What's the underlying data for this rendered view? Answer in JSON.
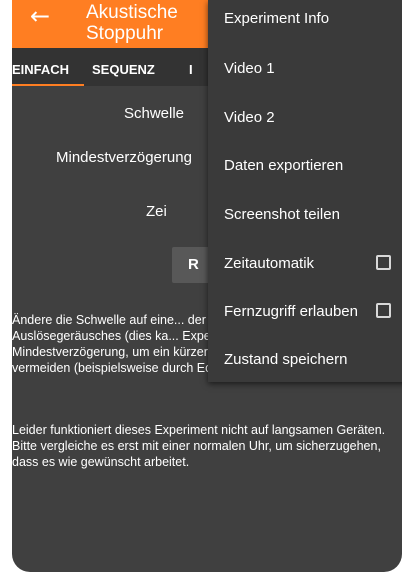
{
  "appbar": {
    "title": "Akustische Stoppuhr",
    "back_icon": "arrow-left-icon"
  },
  "tabs": [
    {
      "label": "EINFACH",
      "active": true
    },
    {
      "label": "SEQUENZ",
      "active": false
    },
    {
      "label": "I",
      "active": false
    }
  ],
  "settings": {
    "threshold_label": "Schwelle",
    "min_delay_label": "Mindestverzögerung",
    "time_label": "Zei",
    "start_button_label": "R"
  },
  "description": {
    "paragraph1": "Ändere die Schwelle auf eine... der Umgebungsgeräusche, a... Auslösegeräusches (dies ka... Experiment \"Audio Oszillosk... Mindestverzögerung, um ein kürzeres Auslösen als diese Zeit zu vermeiden (beispielsweise durch Echos oder Hall).",
    "paragraph2": "Leider funktioniert dieses Experiment nicht auf langsamen Geräten. Bitte vergleiche es erst mit einer normalen Uhr, um sicherzugehen, dass es wie gewünscht arbeitet."
  },
  "overflow_menu": {
    "items": [
      {
        "label": "Experiment Info"
      },
      {
        "label": "Video 1"
      },
      {
        "label": "Video 2"
      },
      {
        "label": "Daten exportieren"
      },
      {
        "label": "Screenshot teilen"
      },
      {
        "label": "Zeitautomatik",
        "checkbox": true,
        "checked": false
      },
      {
        "label": "Fernzugriff erlauben",
        "checkbox": true,
        "checked": false
      },
      {
        "label": "Zustand speichern"
      }
    ]
  },
  "colors": {
    "accent": "#ff7e22",
    "background": "#404040",
    "menu_background": "#3a3a3a"
  }
}
